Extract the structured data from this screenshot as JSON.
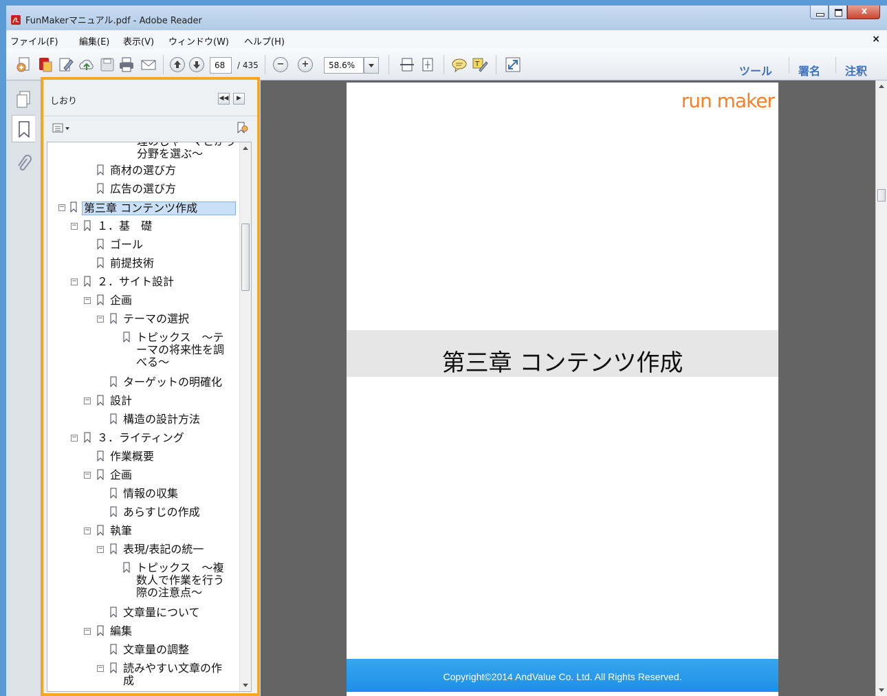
{
  "window": {
    "title": "FunMakerマニュアル.pdf - Adobe Reader",
    "close_glyph": "x"
  },
  "menu": {
    "items": [
      "ファイル(F)",
      "編集(E)",
      "表示(V)",
      "ウィンドウ(W)",
      "ヘルプ(H)"
    ],
    "close_glyph": "×"
  },
  "toolbar": {
    "page_current": "68",
    "page_total": "/ 435",
    "zoom_out_glyph": "−",
    "zoom_in_glyph": "+",
    "zoom_value": "58.6%",
    "tools_label": "ツール",
    "sign_label": "署名",
    "comment_label": "注釈"
  },
  "bookmarks": {
    "title": "しおり",
    "nav_left": "◀◀",
    "nav_right": "▶",
    "options_glyph": "▾",
    "nodes": [
      {
        "label": "理のじャーマとかう\n分野を選ぶ〜",
        "expander": ""
      },
      {
        "label": "商材の選び方",
        "expander": ""
      },
      {
        "label": "広告の選び方",
        "expander": ""
      },
      {
        "label": "第三章 コンテンツ作成",
        "expander": "−",
        "selected": true
      },
      {
        "label": "１．基　礎",
        "expander": "−"
      },
      {
        "label": "ゴール",
        "expander": ""
      },
      {
        "label": "前提技術",
        "expander": ""
      },
      {
        "label": "２．サイト設計",
        "expander": "−"
      },
      {
        "label": "企画",
        "expander": "−"
      },
      {
        "label": "テーマの選択",
        "expander": "−"
      },
      {
        "label": "トピックス　〜テ\nーマの将来性を調\nべる〜",
        "expander": ""
      },
      {
        "label": "ターゲットの明確化",
        "expander": ""
      },
      {
        "label": "設計",
        "expander": "−"
      },
      {
        "label": "構造の設計方法",
        "expander": ""
      },
      {
        "label": "３．ライティング",
        "expander": "−"
      },
      {
        "label": "作業概要",
        "expander": ""
      },
      {
        "label": "企画",
        "expander": "−"
      },
      {
        "label": "情報の収集",
        "expander": ""
      },
      {
        "label": "あらすじの作成",
        "expander": ""
      },
      {
        "label": "執筆",
        "expander": "−"
      },
      {
        "label": "表現/表記の統一",
        "expander": "−"
      },
      {
        "label": "トピックス　〜複\n数人で作業を行う\n際の注意点〜",
        "expander": ""
      },
      {
        "label": "文章量について",
        "expander": ""
      },
      {
        "label": "編集",
        "expander": "−"
      },
      {
        "label": "文章量の調整",
        "expander": ""
      },
      {
        "label": "読みやすい文章の作\n成",
        "expander": "−"
      }
    ]
  },
  "document": {
    "logo_text": "run maker",
    "chapter_title": "第三章 コンテンツ作成",
    "footer_text": "Copyright©2014 AndValue Co. Ltd. All Rights Reserved."
  },
  "colors": {
    "highlight_border": "#f5a623",
    "footer_blue": "#2196e8",
    "logo_orange": "#ff7e21"
  }
}
